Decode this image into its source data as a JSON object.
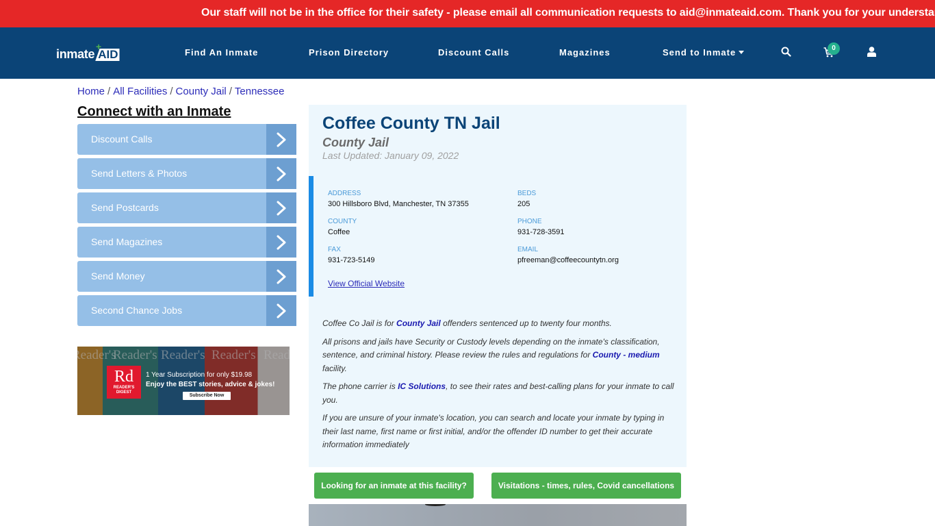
{
  "alert": {
    "text": "Our staff will not be in the office for their safety - please email all communication requests to aid@inmateaid.com. Thank you for your understanding."
  },
  "navbar": {
    "logo": {
      "part1": "inmate",
      "part2": "AID",
      "plus": "+"
    },
    "items": [
      {
        "label": "Find An Inmate"
      },
      {
        "label": "Prison Directory"
      },
      {
        "label": "Discount Calls"
      },
      {
        "label": "Magazines"
      },
      {
        "label": "Send to Inmate",
        "has_dropdown": true
      }
    ],
    "icons": {
      "search": "search-icon",
      "cart": "cart-icon",
      "user": "user-icon"
    },
    "cart_count": "0"
  },
  "breadcrumb": [
    {
      "label": "Home"
    },
    {
      "label": "All Facilities"
    },
    {
      "label": "County Jail"
    },
    {
      "label": "Tennessee"
    }
  ],
  "breadcrumb_separator": "/",
  "sidebar": {
    "title": "Connect with an Inmate",
    "buttons": [
      {
        "label": "Discount Calls"
      },
      {
        "label": "Send Letters & Photos"
      },
      {
        "label": "Send Postcards"
      },
      {
        "label": "Send Magazines"
      },
      {
        "label": "Send Money"
      },
      {
        "label": "Second Chance Jobs"
      }
    ],
    "ad": {
      "logo": "Rd",
      "brand_line1": "READER'S",
      "brand_line2": "DIGEST",
      "magazine_title": "Reader's",
      "line1": "1 Year Subscription for only $19.98",
      "line2": "Enjoy the BEST stories, advice & jokes!",
      "cta": "Subscribe Now"
    }
  },
  "facility": {
    "title": "Coffee County TN Jail",
    "type": "County Jail",
    "last_updated": "Last Updated: January 09, 2022",
    "fields": {
      "address": {
        "label": "ADDRESS",
        "value": "300 Hillsboro Blvd, Manchester, TN 37355"
      },
      "beds": {
        "label": "BEDS",
        "value": "205"
      },
      "county": {
        "label": "COUNTY",
        "value": "Coffee"
      },
      "phone": {
        "label": "PHONE",
        "value": "931-728-3591"
      },
      "fax": {
        "label": "FAX",
        "value": "931-723-5149"
      },
      "email": {
        "label": "EMAIL",
        "value": "pfreeman@coffeecountytn.org"
      }
    },
    "website_link": "View Official Website",
    "description": {
      "p1_before": "Coffee Co Jail is for ",
      "p1_link": "County Jail",
      "p1_after": " offenders sentenced up to twenty four months.",
      "p2_before": "All prisons and jails have Security or Custody levels depending on the inmate's classification, sentence, and criminal history. Please review the rules and regulations for ",
      "p2_link": "County - medium",
      "p2_after": " facility.",
      "p3_before": "The phone carrier is ",
      "p3_link": "IC Solutions",
      "p3_after": ", to see their rates and best-calling plans for your inmate to call you.",
      "p4": "If you are unsure of your inmate's location, you can search and locate your inmate by typing in their last name, first name or first initial, and/or the offender ID number to get their accurate information immediately"
    }
  },
  "actions": {
    "find_inmate": "Looking for an inmate at this facility?",
    "visitations": "Visitations - times, rules, Covid cancellations"
  },
  "colors": {
    "alert_bg": "#e52727",
    "navbar_bg": "#0b4477",
    "sidebar_button": "#95bfe7",
    "sidebar_arrow": "#6d9fd1",
    "panel_bg": "#edf7fd",
    "accent_blue": "#1a8be5",
    "green_button": "#4caf50",
    "cart_badge": "#25b08e"
  }
}
